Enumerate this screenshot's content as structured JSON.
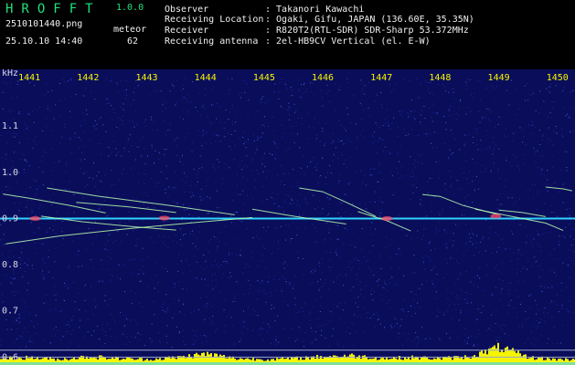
{
  "header": {
    "brand": "HROFFT",
    "version": "1.0.0",
    "filename": "2510101440.png",
    "datetime": "25.10.10 14:40",
    "meteor_label": "meteor",
    "meteor_count": "62",
    "info": [
      {
        "label": "Observer",
        "value": ": Takanori Kawachi"
      },
      {
        "label": "Receiving Location",
        "value": ": Ogaki, Gifu, JAPAN (136.60E, 35.35N)"
      },
      {
        "label": "Receiver",
        "value": ": R820T2(RTL-SDR) SDR-Sharp 53.372MHz"
      },
      {
        "label": "Receiving antenna",
        "value": ": 2el-HB9CV Vertical (el. E-W)"
      }
    ]
  },
  "chart_data": {
    "type": "heatmap",
    "ylabel": "kHz",
    "x_ticks": [
      "1441",
      "1442",
      "1443",
      "1444",
      "1445",
      "1446",
      "1447",
      "1448",
      "1449",
      "1450"
    ],
    "y_ticks": [
      "1.1",
      "1.0",
      "0.9",
      "0.8",
      "0.7",
      "0.6"
    ],
    "y_values": [
      1.1,
      1.0,
      0.9,
      0.8,
      0.7,
      0.6
    ],
    "xlim": [
      1440.5,
      1450.3
    ],
    "ylim": [
      0.583,
      1.205
    ],
    "carrier_khz": 0.9,
    "meteor_traces": [
      {
        "x": [
          1440.55,
          1441.0,
          1441.7,
          1442.3
        ],
        "y": [
          0.953,
          0.944,
          0.928,
          0.912
        ]
      },
      {
        "x": [
          1441.2,
          1441.9,
          1442.8,
          1443.5
        ],
        "y": [
          0.905,
          0.893,
          0.882,
          0.875
        ]
      },
      {
        "x": [
          1440.6,
          1441.5,
          1442.6,
          1443.8,
          1444.8
        ],
        "y": [
          0.845,
          0.862,
          0.877,
          0.891,
          0.902
        ]
      },
      {
        "x": [
          1441.3,
          1442.2,
          1443.4,
          1444.5
        ],
        "y": [
          0.966,
          0.948,
          0.928,
          0.908
        ]
      },
      {
        "x": [
          1441.8,
          1442.7,
          1443.5
        ],
        "y": [
          0.935,
          0.925,
          0.913
        ]
      },
      {
        "x": [
          1444.8,
          1445.5,
          1446.4
        ],
        "y": [
          0.92,
          0.905,
          0.888
        ]
      },
      {
        "x": [
          1445.6,
          1446.0,
          1446.4,
          1446.9
        ],
        "y": [
          0.966,
          0.958,
          0.935,
          0.905
        ]
      },
      {
        "x": [
          1446.6,
          1447.1,
          1447.5
        ],
        "y": [
          0.915,
          0.895,
          0.873
        ]
      },
      {
        "x": [
          1447.7,
          1448.0,
          1448.4,
          1449.0
        ],
        "y": [
          0.952,
          0.948,
          0.928,
          0.908
        ]
      },
      {
        "x": [
          1448.6,
          1449.2,
          1449.8,
          1450.1
        ],
        "y": [
          0.92,
          0.905,
          0.89,
          0.874
        ]
      },
      {
        "x": [
          1449.0,
          1449.4,
          1449.8
        ],
        "y": [
          0.918,
          0.913,
          0.904
        ]
      },
      {
        "x": [
          1449.8,
          1450.1,
          1450.25
        ],
        "y": [
          0.968,
          0.964,
          0.96
        ]
      }
    ],
    "bright_spots": [
      {
        "x": 1441.1,
        "y": 0.9
      },
      {
        "x": 1443.3,
        "y": 0.901
      },
      {
        "x": 1447.1,
        "y": 0.9
      },
      {
        "x": 1448.95,
        "y": 0.905
      }
    ],
    "signal_level_bottom": {
      "x": [
        1440.5,
        1441.0,
        1441.5,
        1442.0,
        1442.5,
        1443.0,
        1443.5,
        1444.0,
        1444.5,
        1445.0,
        1445.5,
        1446.0,
        1446.5,
        1447.0,
        1447.5,
        1448.0,
        1448.5,
        1449.0,
        1449.5,
        1450.0
      ],
      "level": [
        0.35,
        0.4,
        0.3,
        0.45,
        0.35,
        0.3,
        0.4,
        0.6,
        0.35,
        0.3,
        0.35,
        0.45,
        0.5,
        0.35,
        0.4,
        0.35,
        0.45,
        0.95,
        0.4,
        0.3
      ]
    },
    "colors": {
      "background": "#0a0d5a",
      "noise_dim": "#1e2a9c",
      "noise_mid": "#3c5cd8",
      "carrier": "#2fd2ff",
      "trace": "#b8ffb0",
      "hot": "#ff4b6a",
      "level_bar": "#f5f500",
      "level_cyan": "#2fd2ff",
      "axis_text": "#f5f500"
    }
  }
}
